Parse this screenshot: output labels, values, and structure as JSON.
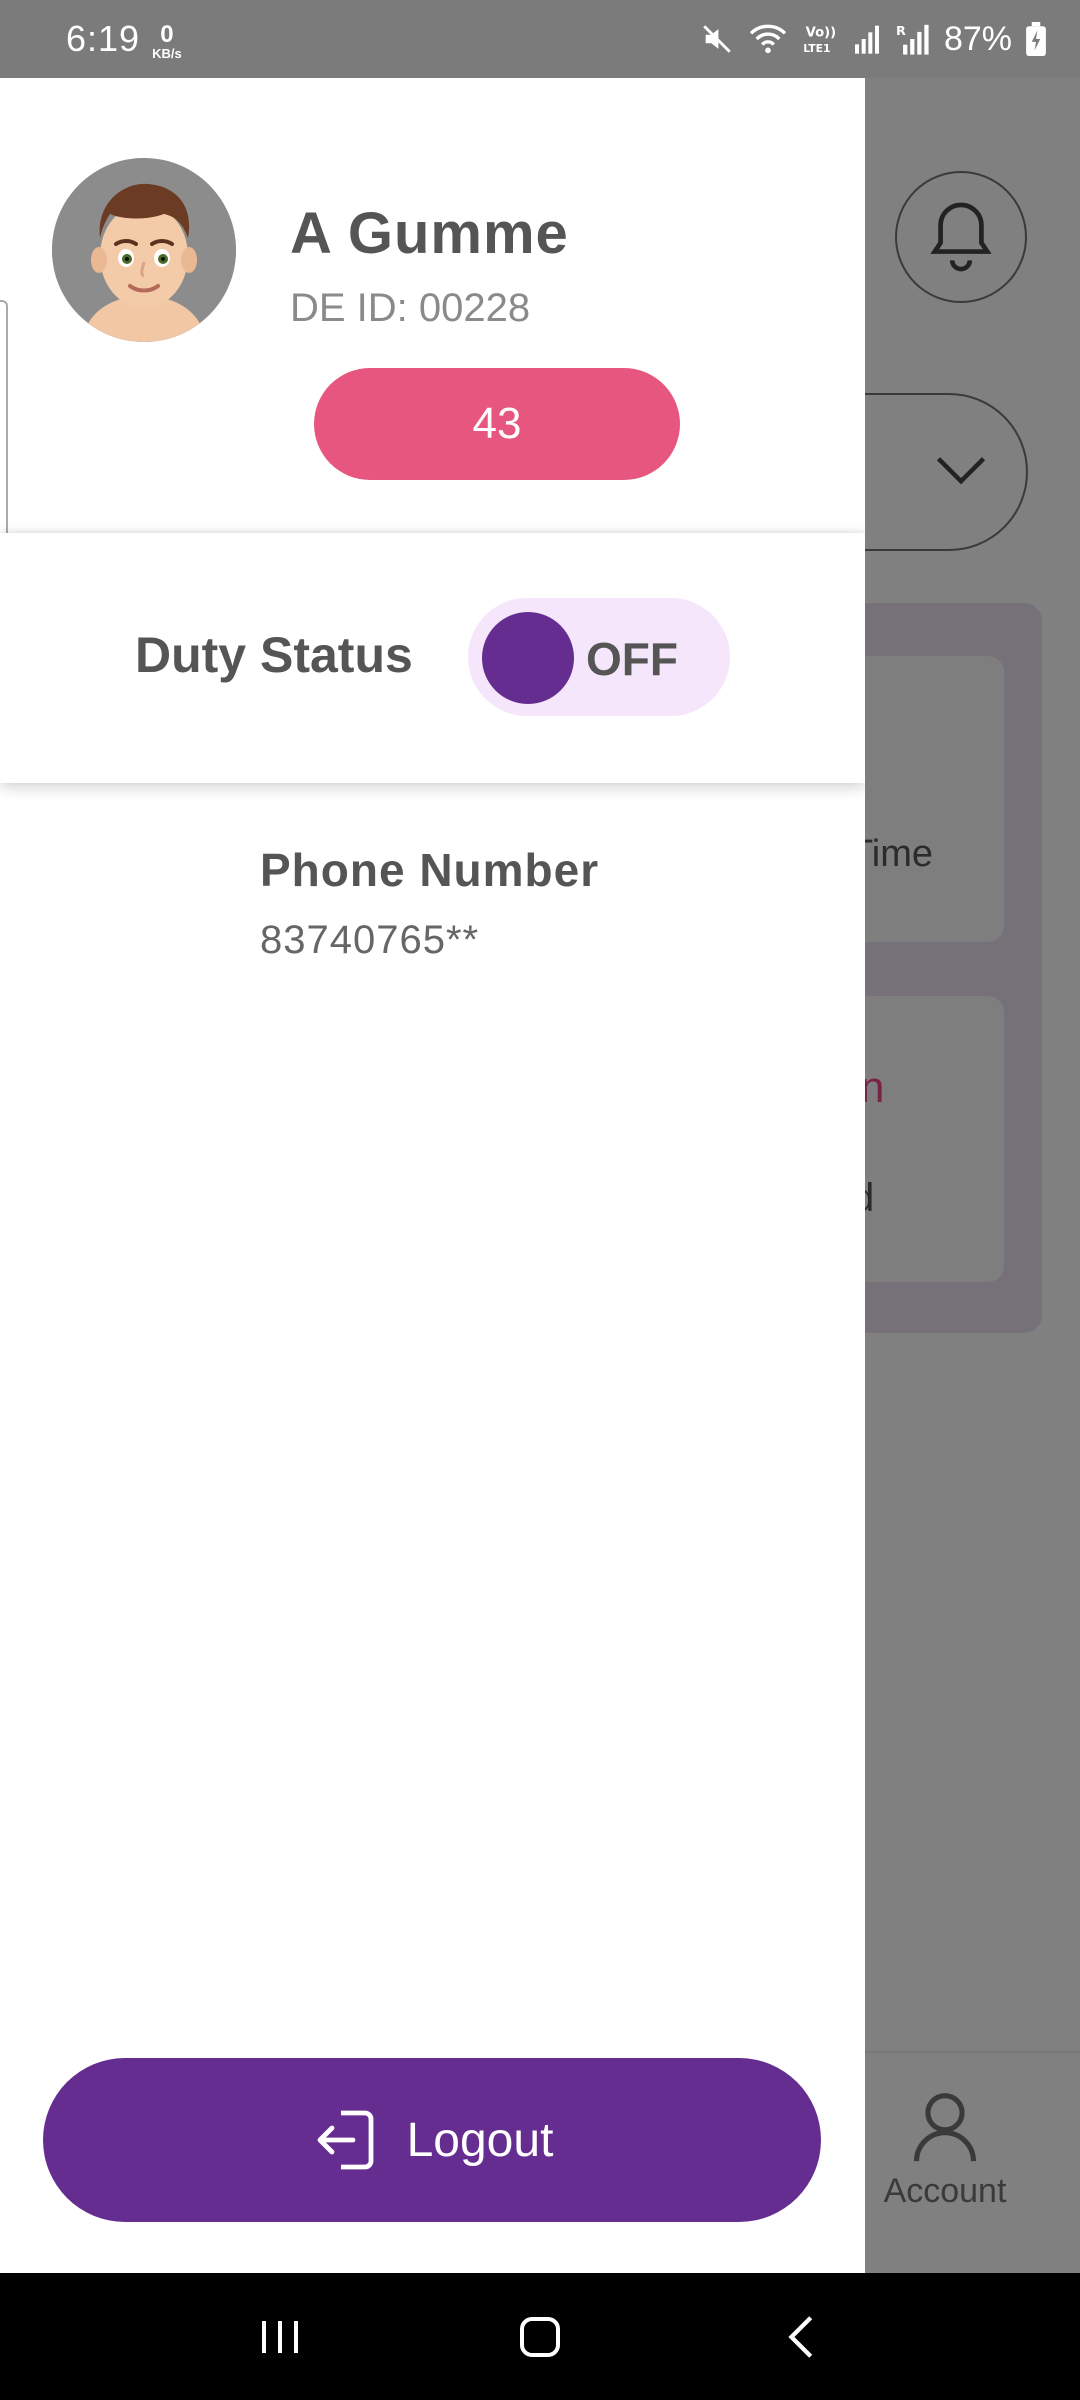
{
  "status_bar": {
    "time": "6:19",
    "net_speed_value": "0",
    "net_speed_unit": "KB/s",
    "battery": "87%",
    "icons": [
      "mute-icon",
      "wifi-icon",
      "volte-icon",
      "signal-icon",
      "roaming-signal-icon",
      "battery-charging-icon"
    ]
  },
  "drawer": {
    "user_name": "A Gumme",
    "de_id": "DE ID: 00228",
    "count_badge": "43",
    "duty_status": {
      "label": "Duty Status",
      "toggle_text": "OFF"
    },
    "phone": {
      "label": "Phone Number",
      "value": "83740765**"
    },
    "logout_label": "Logout"
  },
  "background_app": {
    "text_time": "Time",
    "text_n": "n",
    "text_d": "d",
    "account_tab": "Account"
  },
  "colors": {
    "primary_purple": "#662d91",
    "badge_pink": "#e6567e",
    "toggle_bg": "#f5e6fb"
  }
}
